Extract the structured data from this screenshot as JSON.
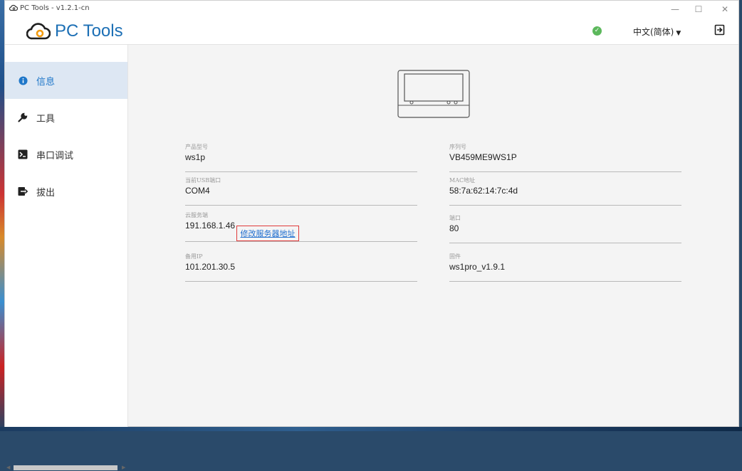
{
  "window": {
    "title": "PC Tools - v1.2.1-cn",
    "min_glyph": "—",
    "max_glyph": "☐",
    "close_glyph": "✕"
  },
  "header": {
    "logo_text": "PC Tools",
    "status_icon": "check-circle-icon",
    "status_color": "#5cb85c",
    "language": "中文(简体)",
    "logout_icon": "sign-out-icon"
  },
  "sidebar": {
    "items": [
      {
        "label": "信息",
        "icon": "info-circle-icon",
        "active": true
      },
      {
        "label": "工具",
        "icon": "wrench-icon",
        "active": false
      },
      {
        "label": "串口调试",
        "icon": "terminal-icon",
        "active": false
      },
      {
        "label": "拔出",
        "icon": "sign-out-icon",
        "active": false
      }
    ]
  },
  "info": {
    "product_model": {
      "label": "产品型号",
      "value": "ws1p"
    },
    "serial_number": {
      "label": "序列号",
      "value": "VB459ME9WS1P"
    },
    "usb_port": {
      "label": "当前USB端口",
      "value": "COM4"
    },
    "mac_address": {
      "label": "MAC地址",
      "value": "58:7a:62:14:7c:4d"
    },
    "cloud_server": {
      "label": "云服务端",
      "value": "191.168.1.46"
    },
    "port": {
      "label": "端口",
      "value": "80"
    },
    "backup_ip": {
      "label": "备用IP",
      "value": "101.201.30.5"
    },
    "firmware": {
      "label": "固件",
      "value": "ws1pro_v1.9.1"
    },
    "modify_server_link": "修改服务器地址"
  },
  "colors": {
    "accent": "#1f77c9",
    "active_nav_bg": "#dde7f3",
    "link_border": "#e03a3a"
  }
}
